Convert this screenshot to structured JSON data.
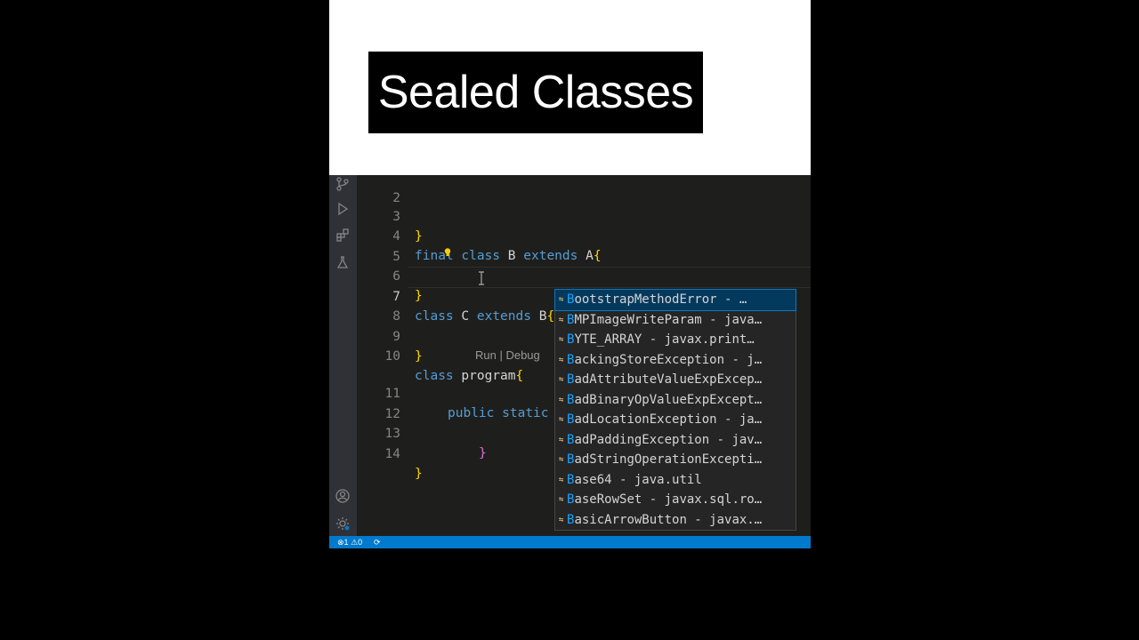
{
  "banner": {
    "title": "Sealed Classes"
  },
  "editor": {
    "lines": [
      {
        "num": "2"
      },
      {
        "num": "3"
      },
      {
        "num": "4",
        "kw1": "final",
        "kw2": "class",
        "name": "B",
        "kw3": "extends",
        "parent": "A",
        "brace": "{"
      },
      {
        "num": "5"
      },
      {
        "num": "6"
      },
      {
        "num": "7",
        "kw1": "class",
        "name": "C",
        "kw2": "extends",
        "parent": "B",
        "brace": "{"
      },
      {
        "num": "8"
      },
      {
        "num": "9"
      },
      {
        "num": "10",
        "kw1": "class",
        "name": "program",
        "brace": "{"
      },
      {
        "num": "11",
        "kw1": "public",
        "kw2": "static"
      },
      {
        "num": "12"
      },
      {
        "num": "13"
      },
      {
        "num": "14"
      }
    ],
    "close_brace": "}",
    "codelens": "Run | Debug"
  },
  "suggestions": {
    "typed": "B",
    "items": [
      {
        "rest": "ootstrapMethodError - …",
        "selected": true
      },
      {
        "rest": "MPImageWriteParam - java…"
      },
      {
        "rest": "YTE_ARRAY - javax.print…"
      },
      {
        "rest": "ackingStoreException - j…"
      },
      {
        "rest": "adAttributeValueExpExcep…"
      },
      {
        "rest": "adBinaryOpValueExpExcept…"
      },
      {
        "rest": "adLocationException - ja…"
      },
      {
        "rest": "adPaddingException - jav…"
      },
      {
        "rest": "adStringOperationExcepti…"
      },
      {
        "rest": "ase64 - java.util"
      },
      {
        "rest": "aseRowSet - javax.sql.ro…"
      },
      {
        "rest": "asicArrowButton - javax.…"
      }
    ]
  },
  "status_bar": {
    "errors": "1",
    "warnings": "0"
  },
  "colors": {
    "status_bar": "#007acc",
    "keyword": "#569cd6",
    "bracket": "#ffd700",
    "match_highlight": "#18a3ff"
  },
  "icons": [
    "source-control-icon",
    "run-debug-icon",
    "extensions-icon",
    "testing-icon",
    "accounts-icon",
    "settings-gear-icon",
    "error-icon",
    "warning-icon",
    "sync-icon",
    "lightbulb-icon"
  ]
}
